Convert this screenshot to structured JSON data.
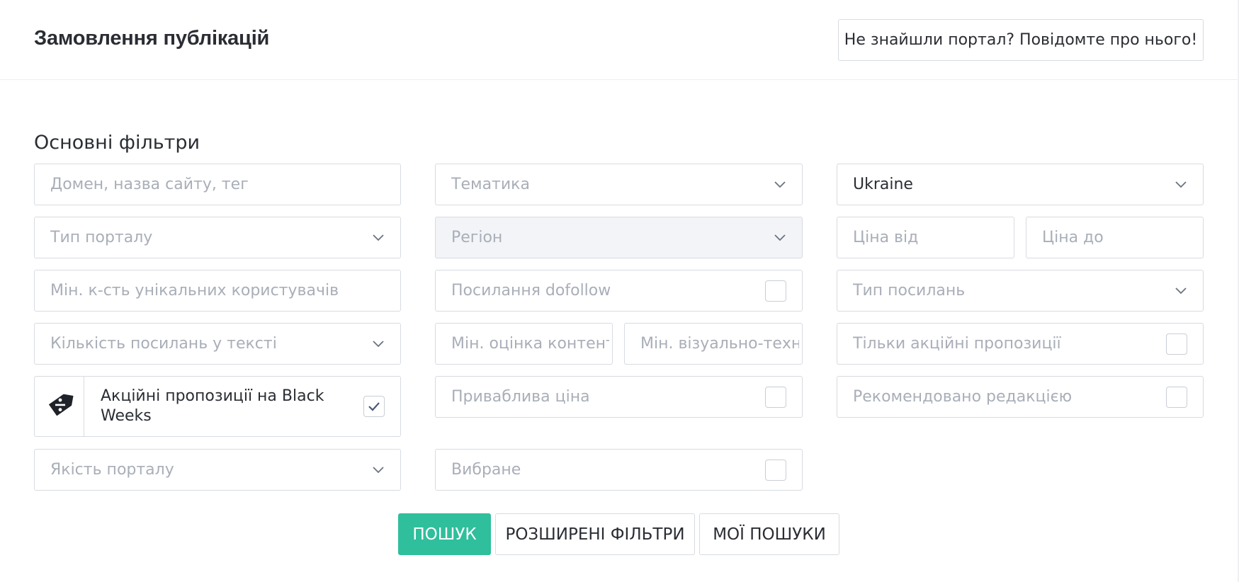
{
  "header": {
    "title": "Замовлення публікацій",
    "report_button": "Не знайшли портал? Повідомте про нього!"
  },
  "filters": {
    "section_title": "Основні фільтри",
    "domain_placeholder": "Домен, назва сайту, тег",
    "topic_placeholder": "Тематика",
    "country_value": "Ukraine",
    "portal_type_placeholder": "Тип порталу",
    "region_placeholder": "Регіон",
    "price_from_placeholder": "Ціна від",
    "price_to_placeholder": "Ціна до",
    "min_users_placeholder": "Мін. к-сть унікальних користувачів",
    "dofollow_label": "Посилання dofollow",
    "dofollow_checked": false,
    "link_type_placeholder": "Тип посилань",
    "links_count_placeholder": "Кількість посилань у тексті",
    "min_content_score_placeholder": "Мін. оцінка контенту",
    "min_visual_score_placeholder": "Мін. візуально-технічна",
    "promo_only_label": "Тільки акційні пропозиції",
    "promo_only_checked": false,
    "black_weeks_label": "Акційні пропозиції на Black Weeks",
    "black_weeks_checked": true,
    "black_weeks_icon": "discount-tag-icon",
    "attractive_price_label": "Приваблива ціна",
    "attractive_price_checked": false,
    "recommended_label": "Рекомендовано редакцією",
    "recommended_checked": false,
    "portal_quality_placeholder": "Якість порталу",
    "favorites_label": "Вибране",
    "favorites_checked": false
  },
  "actions": {
    "search": "ПОШУК",
    "advanced_filters": "РОЗШИРЕНІ ФІЛЬТРИ",
    "my_searches": "МОЇ ПОШУКИ"
  },
  "colors": {
    "accent": "#2fbf9c",
    "border": "#d7dbe1",
    "placeholder": "#a9aeb8",
    "text": "#2a2d33",
    "disabled_bg": "#f2f4f7",
    "check": "#4a5a7a"
  }
}
